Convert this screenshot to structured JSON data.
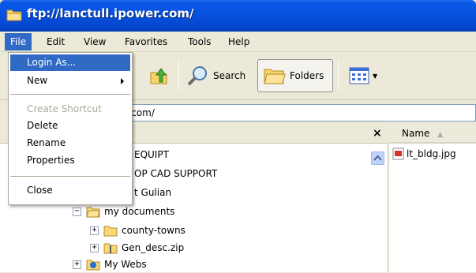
{
  "window": {
    "title": "ftp://lanctull.ipower.com/"
  },
  "menubar": {
    "items": [
      "File",
      "Edit",
      "View",
      "Favorites",
      "Tools",
      "Help"
    ],
    "active": "File"
  },
  "toolbar": {
    "search_label": "Search",
    "folders_label": "Folders"
  },
  "address": {
    "value": "ull.ipower.com/"
  },
  "file_menu": {
    "items": [
      {
        "label": "Login As...",
        "state": "highlighted"
      },
      {
        "label": "New",
        "state": "normal",
        "submenu": true
      },
      {
        "label": "Create Shortcut",
        "state": "disabled"
      },
      {
        "label": "Delete",
        "state": "normal"
      },
      {
        "label": "Rename",
        "state": "normal"
      },
      {
        "label": "Properties",
        "state": "normal"
      },
      {
        "label": "Close",
        "state": "normal"
      }
    ]
  },
  "folder_tree": {
    "close_label": "×",
    "items": [
      {
        "label": "EQUIPT",
        "expander": ""
      },
      {
        "label": "OP CAD SUPPORT",
        "expander": ""
      },
      {
        "label": "t Gulian",
        "expander": ""
      },
      {
        "label": "my documents",
        "expander": "−"
      },
      {
        "label": "county-towns",
        "expander": "+"
      },
      {
        "label": "Gen_desc.zip",
        "expander": "+"
      },
      {
        "label": "My Webs",
        "expander": "+"
      }
    ]
  },
  "files": {
    "column_name": "Name",
    "sort_indicator": "▲",
    "items": [
      "lt_bldg.jpg"
    ]
  },
  "colors": {
    "titlebar": "#0852e0",
    "highlight": "#316ac5",
    "disabled": "#aca899"
  }
}
